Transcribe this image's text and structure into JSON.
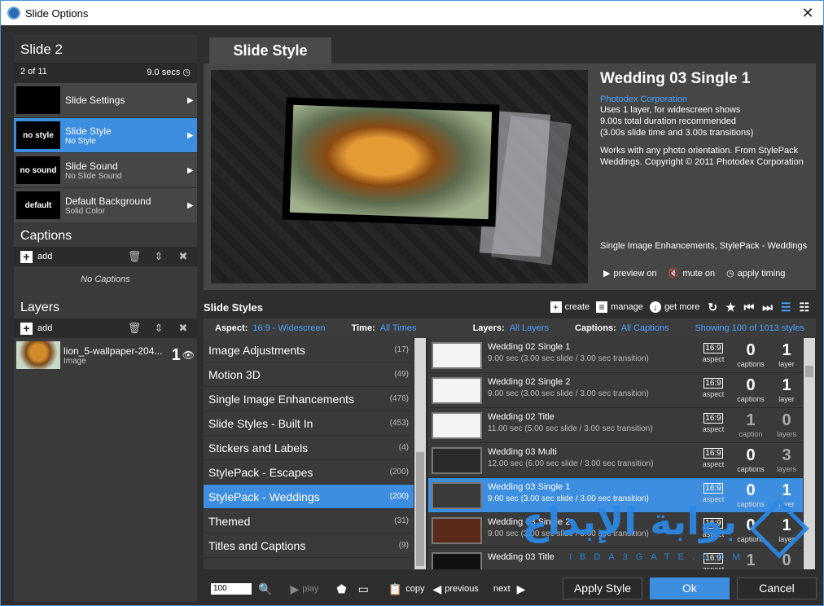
{
  "window": {
    "title": "Slide Options"
  },
  "left": {
    "slide_title": "Slide 2",
    "slide_position": "2 of 11",
    "slide_duration": "9.0 secs",
    "options": [
      {
        "thumb": "",
        "label": "Slide Settings",
        "sub": ""
      },
      {
        "thumb": "no style",
        "label": "Slide Style",
        "sub": "No Style"
      },
      {
        "thumb": "no sound",
        "label": "Slide Sound",
        "sub": "No Slide Sound"
      },
      {
        "thumb": "default",
        "label": "Default Background",
        "sub": "Solid Color"
      }
    ],
    "captions_title": "Captions",
    "captions_add": "add",
    "no_captions": "No Captions",
    "layers_title": "Layers",
    "layers_add": "add",
    "layer": {
      "name": "lion_5-wallpaper-204...",
      "type": "Image",
      "number": "1"
    }
  },
  "tab": {
    "label": "Slide Style"
  },
  "style_info": {
    "name": "Wedding 03 Single 1",
    "company": "Photodex Corporation",
    "lines": [
      "Uses 1 layer, for widescreen shows",
      "9.00s total duration recommended",
      "(3.00s slide time and 3.00s transitions)"
    ],
    "compat": [
      "Works with any photo orientation. From StylePack",
      "Weddings. Copyright © 2011 Photodex Corporation"
    ],
    "tags": "Single Image Enhancements, StylePack - Weddings",
    "actions": {
      "preview": "preview on",
      "mute": "mute on",
      "timing": "apply timing"
    }
  },
  "styles_header": {
    "title": "Slide Styles",
    "create": "create",
    "manage": "manage",
    "get_more": "get more"
  },
  "filters": {
    "aspect_label": "Aspect:",
    "aspect_value": "16:9 - Widescreen",
    "time_label": "Time:",
    "time_value": "All Times",
    "layers_label": "Layers:",
    "layers_value": "All Layers",
    "captions_label": "Captions:",
    "captions_value": "All Captions",
    "showing": "Showing 100 of 1013 styles"
  },
  "categories": [
    {
      "name": "Image Adjustments",
      "count": "(17)"
    },
    {
      "name": "Motion 3D",
      "count": "(49)"
    },
    {
      "name": "Single Image Enhancements",
      "count": "(476)"
    },
    {
      "name": "Slide Styles - Built In",
      "count": "(453)"
    },
    {
      "name": "Stickers and Labels",
      "count": "(4)"
    },
    {
      "name": "StylePack - Escapes",
      "count": "(200)"
    },
    {
      "name": "StylePack - Weddings",
      "count": "(200)"
    },
    {
      "name": "Themed",
      "count": "(31)"
    },
    {
      "name": "Titles and Captions",
      "count": "(9)"
    }
  ],
  "styles": [
    {
      "name": "Wedding 02 Single 1",
      "desc": "9.00 sec (3.00 sec slide / 3.00 sec transition)",
      "aspect": "16:9",
      "aspect_label": "aspect",
      "captions": "0",
      "captions_label": "captions",
      "layers": "1",
      "layers_label": "layer"
    },
    {
      "name": "Wedding 02 Single 2",
      "desc": "9.00 sec (3.00 sec slide / 3.00 sec transition)",
      "aspect": "16:9",
      "aspect_label": "aspect",
      "captions": "0",
      "captions_label": "captions",
      "layers": "1",
      "layers_label": "layer"
    },
    {
      "name": "Wedding 02 Title",
      "desc": "11.00 sec (5.00 sec slide / 3.00 sec transition)",
      "aspect": "16:9",
      "aspect_label": "aspect",
      "captions": "1",
      "captions_label": "caption",
      "layers": "0",
      "layers_label": "layers"
    },
    {
      "name": "Wedding 03 Multi",
      "desc": "12.00 sec (6.00 sec slide / 3.00 sec transition)",
      "aspect": "16:9",
      "aspect_label": "aspect",
      "captions": "0",
      "captions_label": "captions",
      "layers": "3",
      "layers_label": "layers"
    },
    {
      "name": "Wedding 03 Single 1",
      "desc": "9.00 sec (3.00 sec slide / 3.00 sec transition)",
      "aspect": "16:9",
      "aspect_label": "aspect",
      "captions": "0",
      "captions_label": "captions",
      "layers": "1",
      "layers_label": "layer"
    },
    {
      "name": "Wedding 03 Single 2",
      "desc": "9.00 sec (3.00 sec slide / 3.00 sec transition)",
      "aspect": "16:9",
      "aspect_label": "aspect",
      "captions": "0",
      "captions_label": "captions",
      "layers": "1",
      "layers_label": "layer"
    },
    {
      "name": "Wedding 03 Title",
      "desc": "",
      "aspect": "16:9",
      "aspect_label": "aspect",
      "captions": "1",
      "captions_label": "caption",
      "layers": "0",
      "layers_label": "layers"
    }
  ],
  "bottom": {
    "zoom": "100",
    "play": "play",
    "copy": "copy",
    "previous": "previous",
    "next": "next",
    "apply_style": "Apply Style",
    "ok": "Ok",
    "cancel": "Cancel"
  },
  "watermark": {
    "arabic": "بوابة الإبداع",
    "latin": "IBDA3GATE.COM"
  },
  "colors": {
    "accent": "#3d8de0",
    "link": "#4aa3ff",
    "panel": "#2e2e2e"
  }
}
